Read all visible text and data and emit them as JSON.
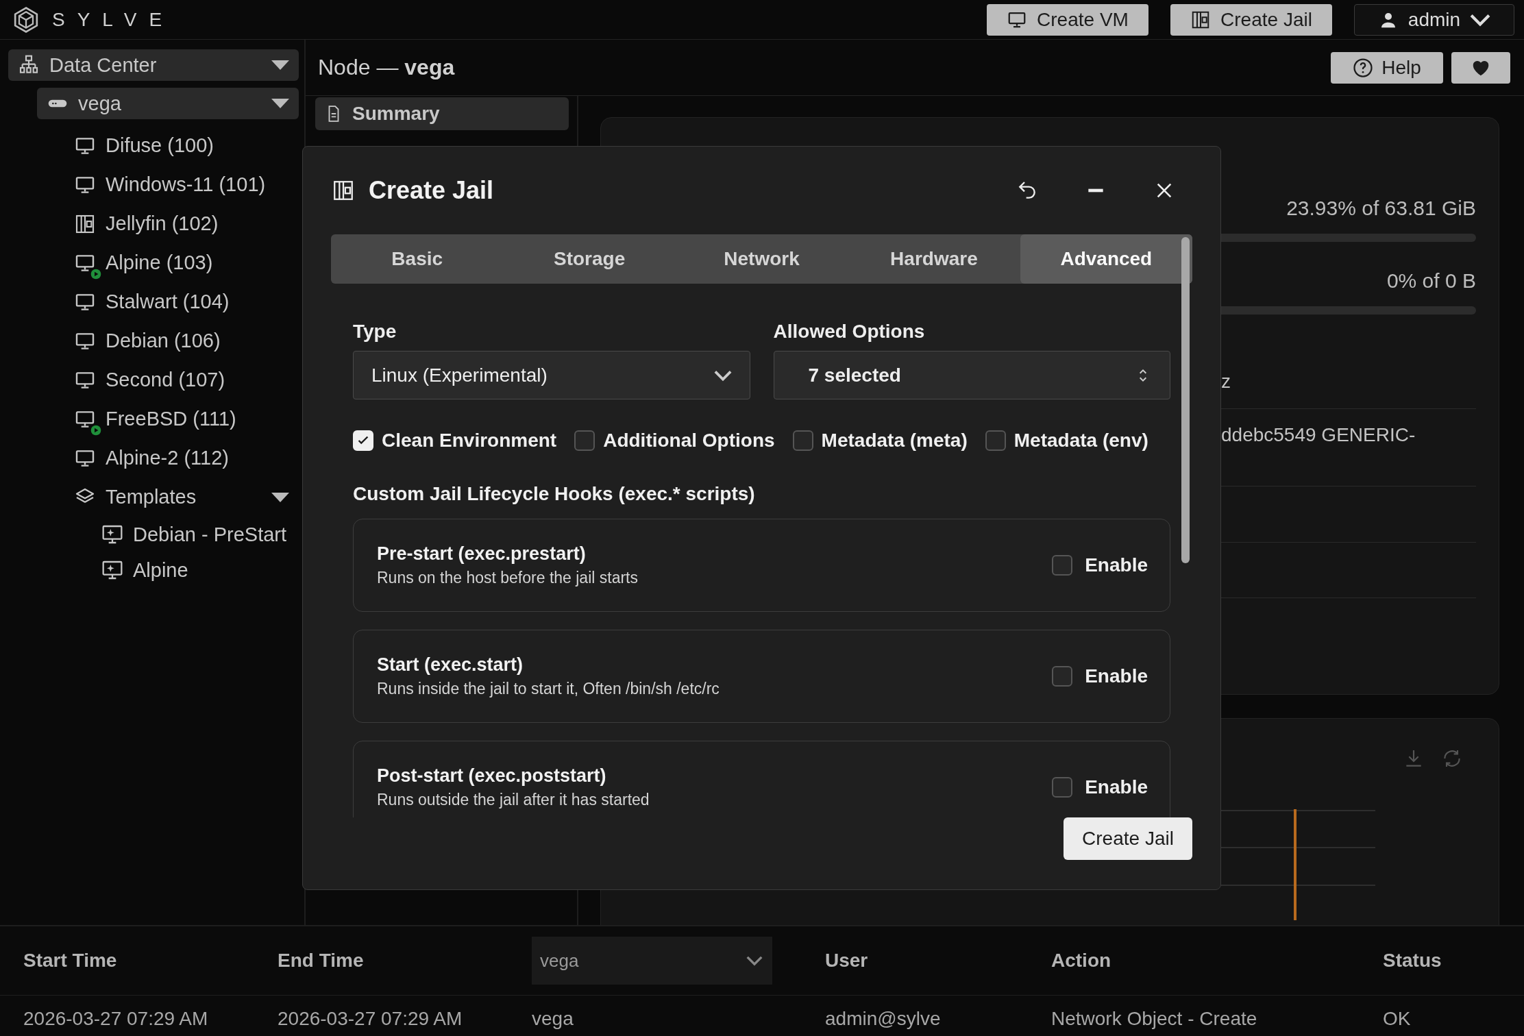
{
  "topbar": {
    "brand": "SYLVE",
    "buttons": [
      {
        "label": "Create VM",
        "kind": "vm"
      },
      {
        "label": "Create Jail",
        "kind": "jail"
      }
    ],
    "user": "admin"
  },
  "sidebar": {
    "tree": [
      {
        "label": "Data Center",
        "kind": "datacenter",
        "expanded": true,
        "children": [
          {
            "label": "vega",
            "kind": "node",
            "expanded": true,
            "children": [
              {
                "label": "Difuse (100)",
                "kind": "vm",
                "running": false
              },
              {
                "label": "Windows-11 (101)",
                "kind": "vm",
                "running": false
              },
              {
                "label": "Jellyfin (102)",
                "kind": "jail",
                "running": false
              },
              {
                "label": "Alpine (103)",
                "kind": "vm",
                "running": true
              },
              {
                "label": "Stalwart (104)",
                "kind": "vm",
                "running": false
              },
              {
                "label": "Debian (106)",
                "kind": "vm",
                "running": false
              },
              {
                "label": "Second (107)",
                "kind": "vm",
                "running": false
              },
              {
                "label": "FreeBSD (111)",
                "kind": "vm",
                "running": true
              },
              {
                "label": "Alpine-2 (112)",
                "kind": "vm",
                "running": false
              },
              {
                "label": "Templates",
                "kind": "group",
                "expanded": true,
                "children": [
                  {
                    "label": "Debian - PreStart",
                    "kind": "template"
                  },
                  {
                    "label": "Alpine",
                    "kind": "template"
                  }
                ]
              }
            ]
          }
        ]
      }
    ]
  },
  "header": {
    "title": "Node — **vega**",
    "help": "Help"
  },
  "nav": [
    {
      "label": "Summary",
      "selected": true
    }
  ],
  "summary": {
    "usage": [
      {
        "reading": "23.93% of 63.81 GiB"
      },
      {
        "reading": "0% of 0 B"
      }
    ],
    "details": [
      {
        "value": "z"
      },
      {
        "value": "ddebc5549 GENERIC-"
      }
    ]
  },
  "modal": {
    "title": "Create Jail",
    "tabs": [
      {
        "label": "Basic",
        "selected": false
      },
      {
        "label": "Storage",
        "selected": false
      },
      {
        "label": "Network",
        "selected": false
      },
      {
        "label": "Hardware",
        "selected": false
      },
      {
        "label": "Advanced",
        "selected": true
      }
    ],
    "fields": [
      {
        "label": "Type",
        "value": "Linux (Experimental)",
        "kind": "select"
      },
      {
        "label": "Allowed Options",
        "value": "7 selected",
        "kind": "multiselect"
      }
    ],
    "options": [
      {
        "label": "Clean Environment",
        "checked": true
      },
      {
        "label": "Additional Options",
        "checked": false
      },
      {
        "label": "Metadata (meta)",
        "checked": false
      },
      {
        "label": "Metadata (env)",
        "checked": false
      }
    ],
    "hooks_title": "Custom Jail Lifecycle Hooks (exec.* scripts)",
    "hooks": [
      {
        "title": "Pre-start (exec.prestart)",
        "description": "Runs on the host before the jail starts",
        "toggle": "Enable",
        "enabled": false
      },
      {
        "title": "Start (exec.start)",
        "description": "Runs inside the jail to start it, Often /bin/sh /etc/rc",
        "toggle": "Enable",
        "enabled": false
      },
      {
        "title": "Post-start (exec.poststart)",
        "description": "Runs outside the jail after it has started",
        "toggle": "Enable",
        "enabled": false
      }
    ],
    "submit": "Create Jail"
  },
  "tasks": {
    "columns": [
      {
        "kind": "text",
        "label": "Start Time"
      },
      {
        "kind": "text",
        "label": "End Time"
      },
      {
        "kind": "filter",
        "value": "vega"
      },
      {
        "kind": "text",
        "label": "User"
      },
      {
        "kind": "text",
        "label": "Action"
      },
      {
        "kind": "text",
        "label": "Status"
      }
    ],
    "rows": [
      [
        "2026-03-27 07:29 AM",
        "2026-03-27 07:29 AM",
        "vega",
        "admin@sylve",
        "Network Object - Create",
        "OK"
      ]
    ]
  }
}
